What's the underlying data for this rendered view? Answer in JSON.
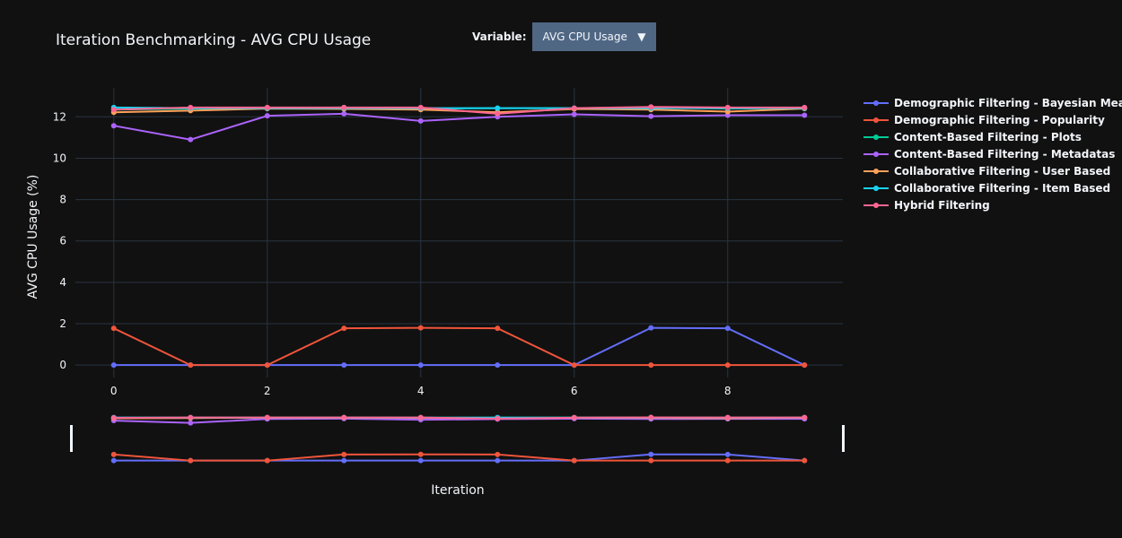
{
  "controls": {
    "variable_label": "Variable:",
    "selected_value": "AVG CPU Usage"
  },
  "colors": {
    "background": "#111111",
    "grid": "#283442",
    "text": "#f2f5fa",
    "dropdown_bg": "#506784"
  },
  "chart_data": {
    "type": "line",
    "title": "Iteration Benchmarking - AVG CPU Usage",
    "xlabel": "Iteration",
    "ylabel": "AVG CPU Usage (%)",
    "xlim": [
      -0.5,
      9.5
    ],
    "ylim": [
      -0.6,
      13.4
    ],
    "xticks": [
      0,
      2,
      4,
      6,
      8
    ],
    "yticks": [
      0,
      2,
      4,
      6,
      8,
      10,
      12
    ],
    "grid": true,
    "legend_position": "right",
    "range_slider": true,
    "x": [
      0,
      1,
      2,
      3,
      4,
      5,
      6,
      7,
      8,
      9
    ],
    "series": [
      {
        "name": "Demographic Filtering - Bayesian Mean",
        "color": "#636efa",
        "values": [
          0,
          0,
          0,
          0,
          0,
          0,
          0,
          1.8,
          1.78,
          0
        ]
      },
      {
        "name": "Demographic Filtering - Popularity",
        "color": "#EF553B",
        "values": [
          1.78,
          0,
          0,
          1.78,
          1.8,
          1.78,
          0,
          0,
          0,
          0
        ]
      },
      {
        "name": "Content-Based Filtering - Plots",
        "color": "#00cc96",
        "values": [
          12.35,
          12.4,
          12.42,
          12.45,
          12.4,
          12.42,
          12.42,
          12.45,
          12.4,
          12.42
        ]
      },
      {
        "name": "Content-Based Filtering - Metadatas",
        "color": "#ab63fa",
        "values": [
          11.57,
          10.9,
          12.05,
          12.15,
          11.8,
          12.0,
          12.12,
          12.03,
          12.08,
          12.08
        ]
      },
      {
        "name": "Collaborative Filtering - User Based",
        "color": "#FFA15A",
        "values": [
          12.22,
          12.3,
          12.4,
          12.38,
          12.35,
          12.22,
          12.38,
          12.35,
          12.25,
          12.4
        ]
      },
      {
        "name": "Collaborative Filtering - Item Based",
        "color": "#19d3f3",
        "values": [
          12.45,
          12.42,
          12.42,
          12.42,
          12.42,
          12.42,
          12.42,
          12.42,
          12.42,
          12.42
        ]
      },
      {
        "name": "Hybrid Filtering",
        "color": "#FF6692",
        "values": [
          12.35,
          12.45,
          12.45,
          12.45,
          12.45,
          12.15,
          12.42,
          12.48,
          12.45,
          12.45
        ]
      }
    ]
  }
}
